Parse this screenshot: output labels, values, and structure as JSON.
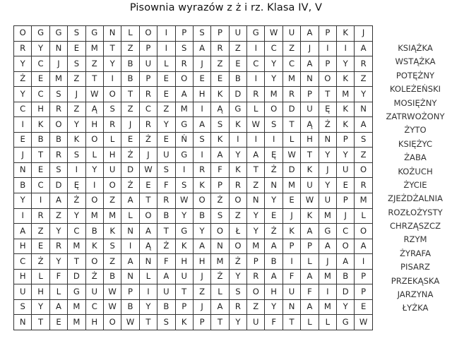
{
  "title": "Pisownia wyrazów z ż i rz. Klasa IV, V",
  "grid": [
    [
      "O",
      "G",
      "G",
      "S",
      "G",
      "N",
      "L",
      "O",
      "I",
      "P",
      "S",
      "P",
      "U",
      "G",
      "W",
      "U",
      "A",
      "P",
      "K",
      "J"
    ],
    [
      "R",
      "Y",
      "N",
      "E",
      "M",
      "T",
      "Z",
      "P",
      "I",
      "S",
      "A",
      "R",
      "Z",
      "I",
      "C",
      "Z",
      "J",
      "I",
      "I",
      "A"
    ],
    [
      "Y",
      "C",
      "J",
      "S",
      "Z",
      "Y",
      "B",
      "U",
      "L",
      "R",
      "J",
      "Z",
      "E",
      "C",
      "Y",
      "C",
      "A",
      "P",
      "Y",
      "R"
    ],
    [
      "Ż",
      "E",
      "M",
      "Z",
      "T",
      "I",
      "B",
      "P",
      "E",
      "O",
      "E",
      "E",
      "B",
      "I",
      "Y",
      "M",
      "N",
      "O",
      "K",
      "Z"
    ],
    [
      "Y",
      "C",
      "S",
      "J",
      "W",
      "O",
      "T",
      "R",
      "E",
      "A",
      "H",
      "K",
      "D",
      "R",
      "M",
      "R",
      "P",
      "T",
      "M",
      "Y"
    ],
    [
      "C",
      "H",
      "R",
      "Z",
      "Ą",
      "S",
      "Z",
      "C",
      "Z",
      "M",
      "I",
      "Ą",
      "G",
      "L",
      "O",
      "D",
      "U",
      "Ę",
      "K",
      "N"
    ],
    [
      "I",
      "K",
      "O",
      "Y",
      "H",
      "R",
      "J",
      "R",
      "Y",
      "G",
      "A",
      "S",
      "K",
      "W",
      "S",
      "T",
      "Ą",
      "Ż",
      "K",
      "A"
    ],
    [
      "E",
      "B",
      "B",
      "K",
      "O",
      "L",
      "E",
      "Ż",
      "E",
      "Ń",
      "S",
      "K",
      "I",
      "I",
      "I",
      "L",
      "H",
      "N",
      "P",
      "S"
    ],
    [
      "J",
      "T",
      "R",
      "S",
      "L",
      "H",
      "Ż",
      "J",
      "U",
      "G",
      "I",
      "A",
      "Y",
      "A",
      "Ę",
      "W",
      "T",
      "Y",
      "Y",
      "Z"
    ],
    [
      "N",
      "E",
      "S",
      "I",
      "Y",
      "U",
      "D",
      "W",
      "S",
      "I",
      "R",
      "F",
      "K",
      "T",
      "Ż",
      "D",
      "K",
      "J",
      "U",
      "O"
    ],
    [
      "B",
      "C",
      "D",
      "Ę",
      "I",
      "O",
      "Ż",
      "E",
      "F",
      "S",
      "K",
      "P",
      "R",
      "Z",
      "N",
      "M",
      "U",
      "Y",
      "E",
      "R"
    ],
    [
      "Y",
      "I",
      "A",
      "Ż",
      "O",
      "Z",
      "A",
      "T",
      "R",
      "W",
      "O",
      "Ż",
      "O",
      "N",
      "Y",
      "E",
      "W",
      "U",
      "P",
      "M"
    ],
    [
      "I",
      "R",
      "Z",
      "Y",
      "M",
      "M",
      "L",
      "O",
      "B",
      "Y",
      "B",
      "S",
      "Z",
      "Y",
      "E",
      "J",
      "K",
      "M",
      "J",
      "L"
    ],
    [
      "A",
      "Z",
      "Y",
      "C",
      "B",
      "K",
      "N",
      "A",
      "T",
      "G",
      "Y",
      "O",
      "Ł",
      "Y",
      "Ż",
      "K",
      "A",
      "G",
      "C",
      "O"
    ],
    [
      "H",
      "E",
      "R",
      "M",
      "K",
      "S",
      "I",
      "Ą",
      "Ż",
      "K",
      "A",
      "N",
      "O",
      "M",
      "A",
      "P",
      "P",
      "A",
      "O",
      "A"
    ],
    [
      "C",
      "Ż",
      "Y",
      "T",
      "O",
      "Z",
      "A",
      "N",
      "F",
      "H",
      "H",
      "M",
      "Ż",
      "P",
      "B",
      "I",
      "L",
      "J",
      "A",
      "I"
    ],
    [
      "H",
      "L",
      "F",
      "D",
      "Ż",
      "B",
      "N",
      "L",
      "A",
      "U",
      "J",
      "Ż",
      "Y",
      "R",
      "A",
      "F",
      "A",
      "M",
      "B",
      "P"
    ],
    [
      "U",
      "H",
      "L",
      "G",
      "U",
      "W",
      "P",
      "I",
      "U",
      "T",
      "Z",
      "L",
      "S",
      "O",
      "H",
      "U",
      "F",
      "I",
      "D",
      "P"
    ],
    [
      "S",
      "Y",
      "A",
      "M",
      "C",
      "W",
      "B",
      "Y",
      "B",
      "P",
      "J",
      "A",
      "R",
      "Z",
      "Y",
      "N",
      "A",
      "M",
      "Y",
      "E"
    ],
    [
      "N",
      "T",
      "E",
      "M",
      "H",
      "O",
      "W",
      "T",
      "S",
      "K",
      "P",
      "T",
      "Y",
      "U",
      "F",
      "T",
      "L",
      "L",
      "G",
      "W"
    ]
  ],
  "words": [
    "KSIĄŻKA",
    "WSTĄŻKA",
    "POTĘŻNY",
    "KOLEŻEŃSKI",
    "MOSIĘŻNY",
    "ZATRWOŻONY",
    "ŻYTO",
    "KSIĘŻYC",
    "ŻABA",
    "KOŻUCH",
    "ŻYCIE",
    "ZJEŻDŻALNIA",
    "ROZŁOŻYSTY",
    "CHRZĄSZCZ",
    "RZYM",
    "ŻYRAFA",
    "PISARZ",
    "PRZEKĄSKA",
    "JARZYNA",
    "ŁYŻKA"
  ]
}
